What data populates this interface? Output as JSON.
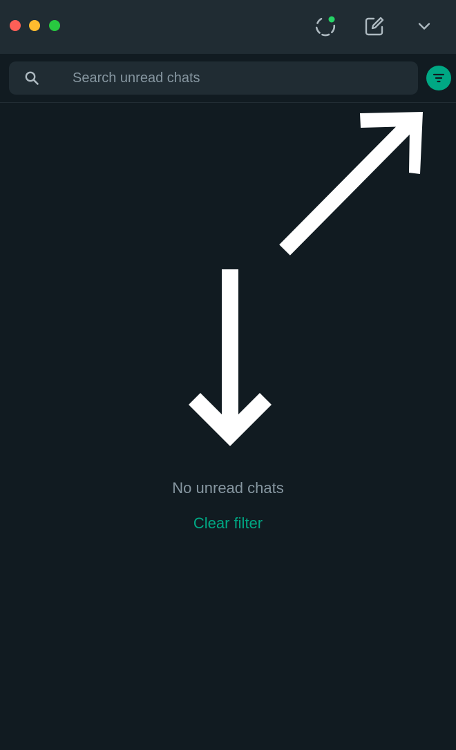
{
  "header": {
    "window_controls": [
      "close",
      "minimize",
      "maximize"
    ],
    "icons": {
      "status": "status-icon",
      "new_chat": "new-chat-icon",
      "menu": "chevron-down-icon"
    },
    "status_dot_color": "#25d366"
  },
  "search": {
    "placeholder": "Search unread chats",
    "value": "",
    "icon": "search-icon",
    "filter_icon": "filter-icon",
    "filter_active_color": "#00a884"
  },
  "empty_state": {
    "message": "No unread chats",
    "action_label": "Clear filter"
  },
  "colors": {
    "background": "#111b21",
    "panel": "#202c33",
    "accent": "#00a884",
    "muted_text": "#8696a0"
  }
}
